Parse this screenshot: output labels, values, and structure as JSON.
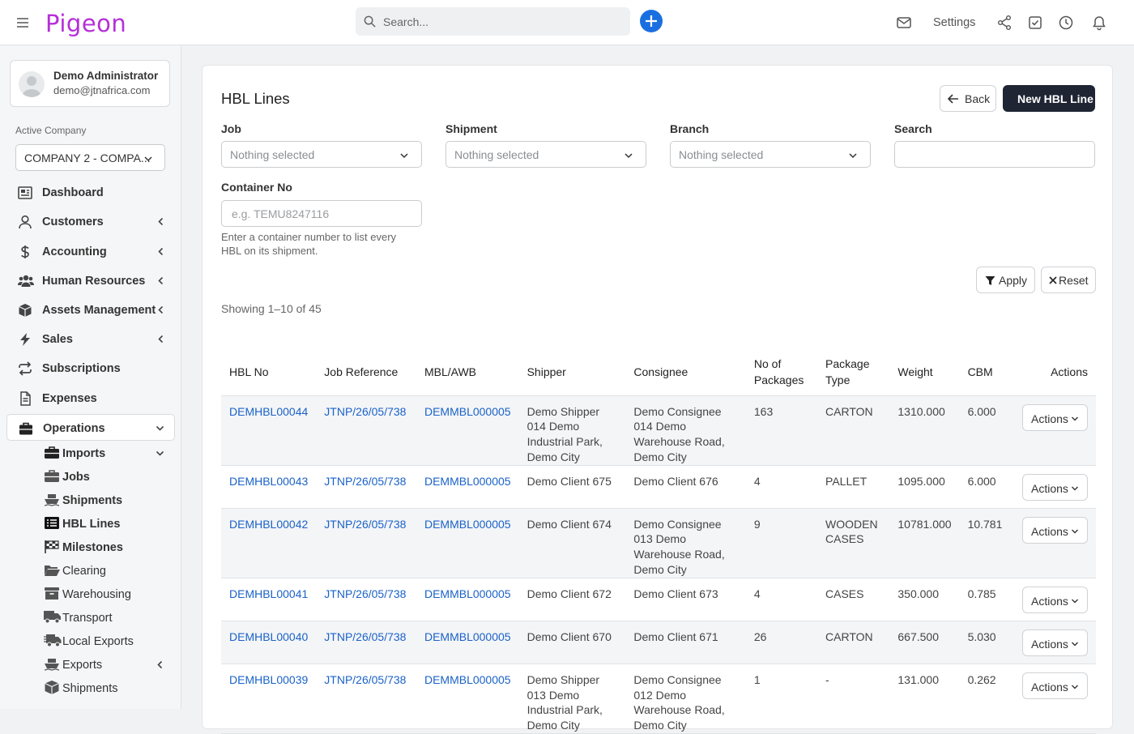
{
  "app": {
    "logo": "Pigeon"
  },
  "topbar": {
    "search_placeholder": "Search...",
    "settings_label": "Settings"
  },
  "user": {
    "name": "Demo Administrator",
    "email": "demo@jtnafrica.com"
  },
  "company": {
    "label": "Active Company",
    "selected": "COMPANY 2 - COMPA..."
  },
  "nav": [
    {
      "label": "Dashboard",
      "icon": "dashboard-icon"
    },
    {
      "label": "Customers",
      "icon": "user-icon"
    },
    {
      "label": "Accounting",
      "icon": "dollar-icon"
    },
    {
      "label": "Human Resources",
      "icon": "users-icon"
    },
    {
      "label": "Assets Management",
      "icon": "cube-icon"
    },
    {
      "label": "Sales",
      "icon": "bolt-icon"
    },
    {
      "label": "Subscriptions",
      "icon": "repeat-icon"
    },
    {
      "label": "Expenses",
      "icon": "file-icon"
    },
    {
      "label": "Operations",
      "icon": "briefcase-icon"
    }
  ],
  "subnav": [
    {
      "label": "Imports",
      "icon": "briefcase-icon"
    },
    {
      "label": "Jobs",
      "icon": "briefcase-icon"
    },
    {
      "label": "Shipments",
      "icon": "ship-icon"
    },
    {
      "label": "HBL Lines",
      "icon": "list-icon"
    },
    {
      "label": "Milestones",
      "icon": "flag-checkered-icon"
    },
    {
      "label": "Clearing",
      "icon": "folder-open-icon"
    },
    {
      "label": "Warehousing",
      "icon": "archive-icon"
    },
    {
      "label": "Transport",
      "icon": "truck-icon"
    },
    {
      "label": "Local Exports",
      "icon": "truck-fast-icon"
    },
    {
      "label": "Exports",
      "icon": "ship-icon"
    },
    {
      "label": "Shipments",
      "icon": "box-icon"
    }
  ],
  "page": {
    "title": "HBL Lines",
    "back_label": "Back",
    "new_label": "New HBL Line",
    "filters": {
      "job_label": "Job",
      "job_value": "Nothing selected",
      "shipment_label": "Shipment",
      "shipment_value": "Nothing selected",
      "branch_label": "Branch",
      "branch_value": "Nothing selected",
      "search_label": "Search",
      "search_value": "",
      "container_label": "Container No",
      "container_placeholder": "e.g. TEMU8247116",
      "container_help": "Enter a container number to list every HBL on its shipment.",
      "apply_label": "Apply",
      "reset_label": "Reset"
    },
    "showing": "Showing 1–10 of 45"
  },
  "table": {
    "headers": [
      "HBL No",
      "Job Reference",
      "MBL/AWB",
      "Shipper",
      "Consignee",
      "No of Packages",
      "Package Type",
      "Weight",
      "CBM",
      "Actions"
    ],
    "action_label": "Actions",
    "rows": [
      {
        "hbl": "DEMHBL00044",
        "job": "JTNP/26/05/738",
        "mbl": "DEMMBL000005",
        "shipper": "Demo Shipper 014 Demo Industrial Park, Demo City",
        "consignee": "Demo Consignee 014 Demo Warehouse Road, Demo City",
        "packages": "163",
        "type": "CARTON",
        "weight": "1310.000",
        "cbm": "6.000"
      },
      {
        "hbl": "DEMHBL00043",
        "job": "JTNP/26/05/738",
        "mbl": "DEMMBL000005",
        "shipper": "Demo Client 675",
        "consignee": "Demo Client 676",
        "packages": "4",
        "type": "PALLET",
        "weight": "1095.000",
        "cbm": "6.000"
      },
      {
        "hbl": "DEMHBL00042",
        "job": "JTNP/26/05/738",
        "mbl": "DEMMBL000005",
        "shipper": "Demo Client 674",
        "consignee": "Demo Consignee 013 Demo Warehouse Road, Demo City",
        "packages": "9",
        "type": "WOODEN CASES",
        "weight": "10781.000",
        "cbm": "10.781"
      },
      {
        "hbl": "DEMHBL00041",
        "job": "JTNP/26/05/738",
        "mbl": "DEMMBL000005",
        "shipper": "Demo Client 672",
        "consignee": "Demo Client 673",
        "packages": "4",
        "type": "CASES",
        "weight": "350.000",
        "cbm": "0.785"
      },
      {
        "hbl": "DEMHBL00040",
        "job": "JTNP/26/05/738",
        "mbl": "DEMMBL000005",
        "shipper": "Demo Client 670",
        "consignee": "Demo Client 671",
        "packages": "26",
        "type": "CARTON",
        "weight": "667.500",
        "cbm": "5.030"
      },
      {
        "hbl": "DEMHBL00039",
        "job": "JTNP/26/05/738",
        "mbl": "DEMMBL000005",
        "shipper": "Demo Shipper 013 Demo Industrial Park, Demo City",
        "consignee": "Demo Consignee 012 Demo Warehouse Road, Demo City",
        "packages": "1",
        "type": "-",
        "weight": "131.000",
        "cbm": "0.262"
      }
    ]
  },
  "colors": {
    "brand": "#b62fd8",
    "link": "#1a62c8",
    "primary_button": "#1f2533",
    "add_button": "#1a6fe0"
  }
}
